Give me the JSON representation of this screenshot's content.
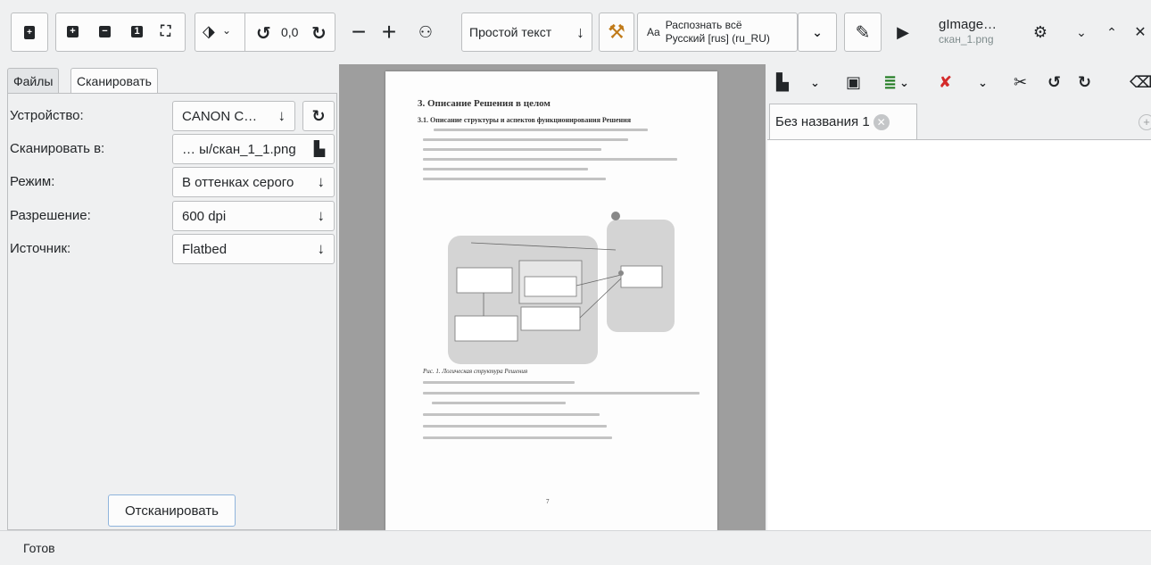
{
  "toolbar": {
    "rotation_value": "0,0",
    "text_layer_label": "Простой текст",
    "ocr_title": "Распознать всё",
    "ocr_language": "Русский [rus] (ru_RU)",
    "app_title": "gImage…",
    "app_subtitle": "скан_1.png"
  },
  "left_tabs": {
    "files_label": "Файлы",
    "scan_label": "Сканировать"
  },
  "scan_form": {
    "device_label": "Устройство:",
    "device_value": "CANON C…",
    "scan_to_label": "Сканировать в:",
    "scan_to_value": "… ы/скан_1_1.png",
    "mode_label": "Режим:",
    "mode_value": "В оттенках серого",
    "resolution_label": "Разрешение:",
    "resolution_value": "600 dpi",
    "source_label": "Источник:",
    "source_value": "Flatbed",
    "scan_button": "Отсканировать"
  },
  "document": {
    "tab_title": "Без названия 1"
  },
  "scanned_page": {
    "heading": "3.   Описание Решения в целом",
    "subheading": "3.1.   Описание структуры и аспектов функционирования Решения",
    "caption": "Рис. 1. Логическая структура Решения",
    "page_number": "7"
  },
  "status": {
    "text": "Готов"
  }
}
